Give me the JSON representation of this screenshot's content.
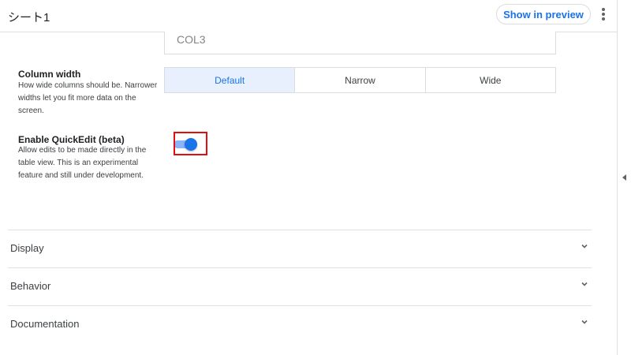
{
  "header": {
    "title": "シート1",
    "preview_button": "Show in preview",
    "more_icon": "more-vert-icon"
  },
  "column_field": {
    "value": "COL3"
  },
  "column_width": {
    "title": "Column width",
    "description": "How wide columns should be. Narrower widths let you fit more data on the screen.",
    "options": [
      "Default",
      "Narrow",
      "Wide"
    ],
    "selected": "Default"
  },
  "quickedit": {
    "title": "Enable QuickEdit (beta)",
    "description": "Allow edits to be made directly in the table view. This is an experimental feature and still under development.",
    "enabled": true
  },
  "sections": [
    {
      "label": "Display",
      "icon": "chevron-down-icon"
    },
    {
      "label": "Behavior",
      "icon": "chevron-down-icon"
    },
    {
      "label": "Documentation",
      "icon": "chevron-down-icon"
    }
  ],
  "colors": {
    "accent": "#1a73e8",
    "selected_bg": "#e8f0fe",
    "highlight_box": "#e01010"
  }
}
